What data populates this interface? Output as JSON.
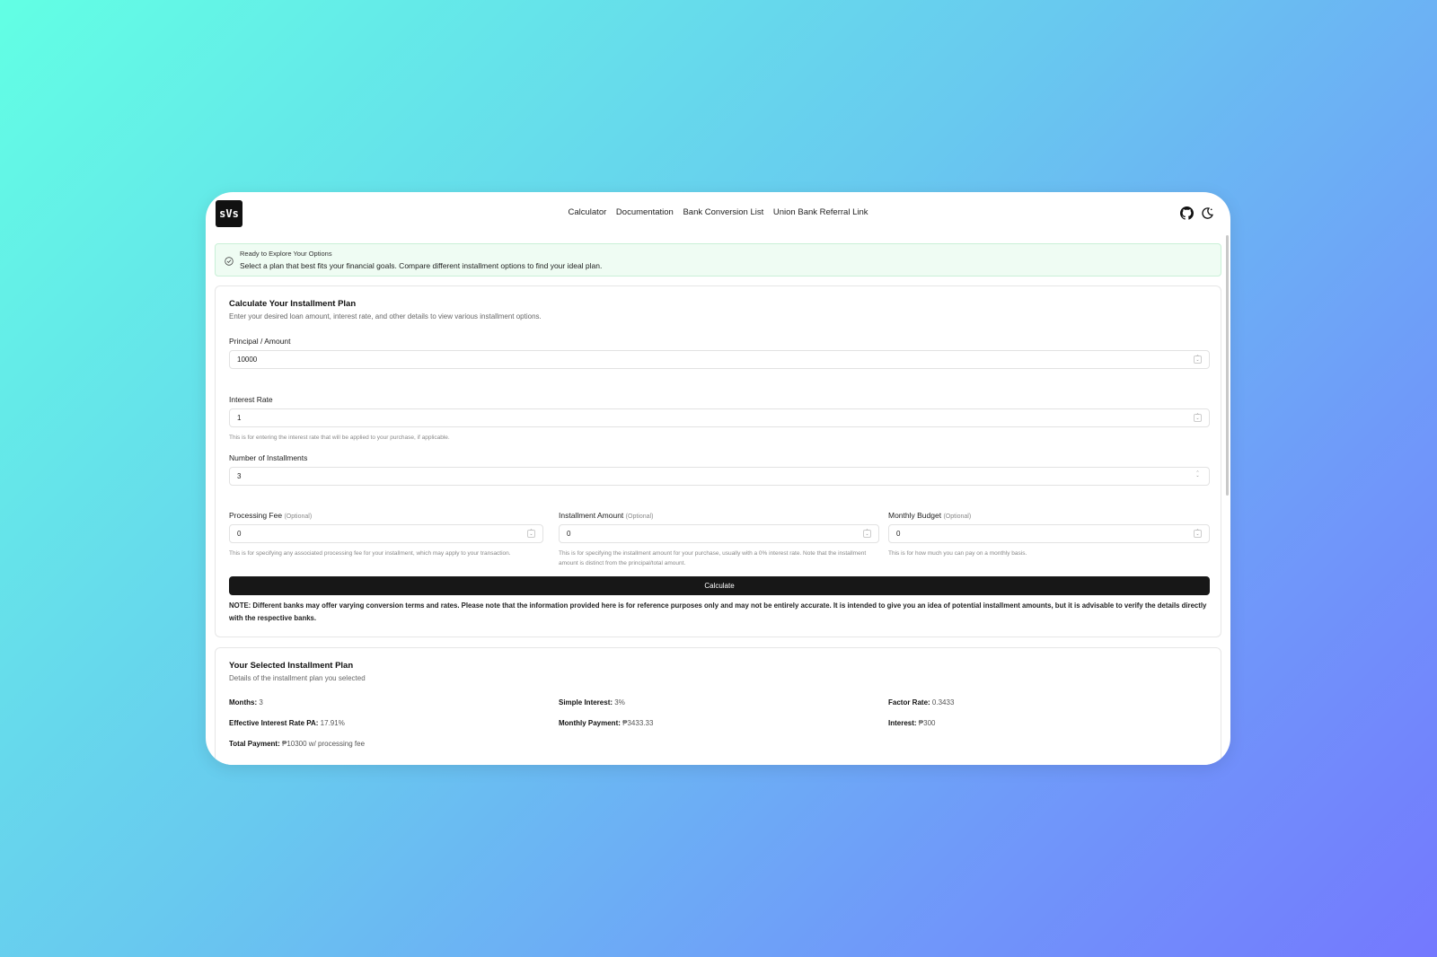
{
  "app": {
    "logo_text": "sVs"
  },
  "nav": {
    "links": [
      "Calculator",
      "Documentation",
      "Bank Conversion List",
      "Union Bank Referral Link"
    ],
    "icons": [
      "github-icon",
      "theme-toggle-icon"
    ]
  },
  "alert": {
    "title": "Ready to Explore Your Options",
    "description": "Select a plan that best fits your financial goals. Compare different installment options to find your ideal plan."
  },
  "calculator": {
    "title": "Calculate Your Installment Plan",
    "description": "Enter your desired loan amount, interest rate, and other details to view various installment options.",
    "principal": {
      "label": "Principal / Amount",
      "value": "10000"
    },
    "interest_rate": {
      "label": "Interest Rate",
      "value": "1",
      "help": "This is for entering the interest rate that will be applied to your purchase, if applicable."
    },
    "installments": {
      "label": "Number of Installments",
      "value": "3"
    },
    "processing_fee": {
      "label": "Processing Fee",
      "optional": "(Optional)",
      "value": "0",
      "help": "This is for specifying any associated processing fee for your installment, which may apply to your transaction."
    },
    "installment_amount": {
      "label": "Installment Amount",
      "optional": "(Optional)",
      "value": "0",
      "help": "This is for specifying the installment amount for your purchase, usually with a 0% interest rate. Note that the installment amount is distinct from the principal/total amount."
    },
    "monthly_budget": {
      "label": "Monthly Budget",
      "optional": "(Optional)",
      "value": "0",
      "help": "This is for how much you can pay on a monthly basis."
    },
    "button_label": "Calculate",
    "note": "NOTE: Different banks may offer varying conversion terms and rates. Please note that the information provided here is for reference purposes only and may not be entirely accurate. It is intended to give you an idea of potential installment amounts, but it is advisable to verify the details directly with the respective banks."
  },
  "selected_plan": {
    "title": "Your Selected Installment Plan",
    "description": "Details of the installment plan you selected",
    "rows": [
      {
        "label": "Months:",
        "value": "3"
      },
      {
        "label": "Simple Interest:",
        "value": "3%"
      },
      {
        "label": "Factor Rate:",
        "value": "0.3433"
      },
      {
        "label": "Effective Interest Rate PA:",
        "value": "17.91%"
      },
      {
        "label": "Monthly Payment:",
        "value": "₱3433.33"
      },
      {
        "label": "Interest:",
        "value": "₱300"
      },
      {
        "label": "Total Payment:",
        "value": "₱10300 w/ processing fee"
      }
    ]
  }
}
